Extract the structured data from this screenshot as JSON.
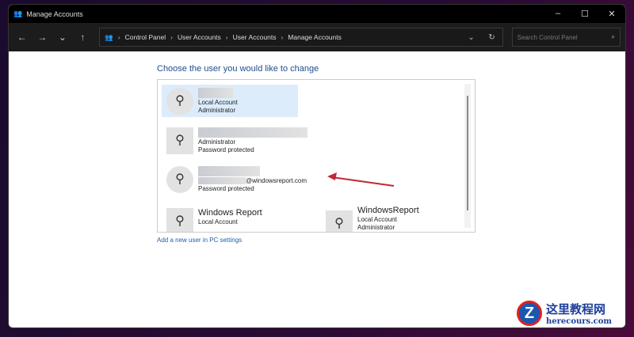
{
  "window": {
    "title": "Manage Accounts",
    "minimize": "–",
    "maximize": "☐",
    "close": "✕"
  },
  "toolbar": {
    "back": "←",
    "forward": "→",
    "recent": "⌄",
    "up": "↑",
    "breadcrumb": [
      "Control Panel",
      "User Accounts",
      "User Accounts",
      "Manage Accounts"
    ],
    "dropdown": "⌄",
    "refresh": "↻",
    "search_placeholder": "Search Control Panel",
    "search_icon": "⌕"
  },
  "main": {
    "heading": "Choose the user you would like to change",
    "users": [
      {
        "lines": [
          "Local Account",
          "Administrator"
        ]
      },
      {
        "lines": [
          "Administrator",
          "Password protected"
        ]
      },
      {
        "email_suffix": "@windowsreport.com",
        "lines": [
          "Password protected"
        ]
      },
      {
        "name": "Windows Report",
        "lines": [
          "Local Account"
        ]
      },
      {
        "name": "WindowsReport",
        "lines": [
          "Local Account",
          "Administrator"
        ]
      }
    ],
    "add_user_link": "Add a new user in PC settings"
  },
  "watermark": {
    "title": "这里教程网",
    "url": "herecours.com"
  },
  "colors": {
    "heading": "#1e4e8c",
    "selected": "#dcecfb",
    "arrow": "#c0283a"
  }
}
